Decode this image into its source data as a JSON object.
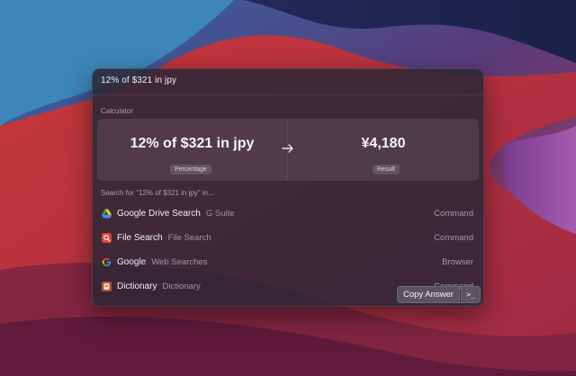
{
  "query": {
    "text": "12% of $321 in jpy"
  },
  "calculator": {
    "section_title": "Calculator",
    "expression": "12% of $321 in jpy",
    "expression_badge": "Percentage",
    "arrow_icon": "arrow-right-icon",
    "result": "¥4,180",
    "result_badge": "Result"
  },
  "search": {
    "header": "Search for \"12% of $321 in jpy\" in...",
    "results": [
      {
        "title": "Google Drive Search",
        "subtitle": "G Suite",
        "kind": "Command",
        "icon": "google-drive-icon"
      },
      {
        "title": "File Search",
        "subtitle": "File Search",
        "kind": "Command",
        "icon": "file-search-icon"
      },
      {
        "title": "Google",
        "subtitle": "Web Searches",
        "kind": "Browser",
        "icon": "google-icon"
      },
      {
        "title": "Dictionary",
        "subtitle": "Dictionary",
        "kind": "Command",
        "icon": "dictionary-icon"
      }
    ]
  },
  "actions": {
    "copy_label": "Copy Answer",
    "terminal_label": ">_"
  },
  "colors": {
    "panel_bg": "#2c2634",
    "accent_red": "#d8443a",
    "wallpaper_blue": "#3a7ab0",
    "wallpaper_navy": "#1d2147"
  }
}
